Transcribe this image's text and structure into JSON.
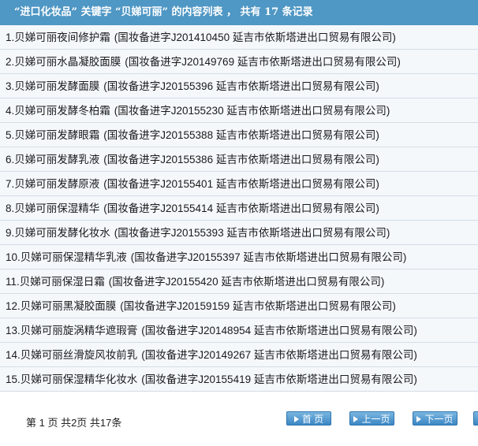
{
  "header": {
    "title": "“进口化妆品” 关键字 “贝娣可丽” 的内容列表 ， 共有 17 条记录"
  },
  "items": [
    {
      "index": "1.",
      "name": "贝娣可丽夜间修护霜",
      "detail": "(国妆备进字J201410450 延吉市依斯塔进出口贸易有限公司)"
    },
    {
      "index": "2.",
      "name": "贝娣可丽水晶凝胶面膜",
      "detail": "(国妆备进字J20149769 延吉市依斯塔进出口贸易有限公司)"
    },
    {
      "index": "3.",
      "name": "贝娣可丽发酵面膜",
      "detail": "(国妆备进字J20155396 延吉市依斯塔进出口贸易有限公司)"
    },
    {
      "index": "4.",
      "name": "贝娣可丽发酵冬柏霜",
      "detail": "(国妆备进字J20155230 延吉市依斯塔进出口贸易有限公司)"
    },
    {
      "index": "5.",
      "name": "贝娣可丽发酵眼霜",
      "detail": "(国妆备进字J20155388 延吉市依斯塔进出口贸易有限公司)"
    },
    {
      "index": "6.",
      "name": "贝娣可丽发酵乳液",
      "detail": "(国妆备进字J20155386 延吉市依斯塔进出口贸易有限公司)"
    },
    {
      "index": "7.",
      "name": "贝娣可丽发酵原液",
      "detail": "(国妆备进字J20155401 延吉市依斯塔进出口贸易有限公司)"
    },
    {
      "index": "8.",
      "name": "贝娣可丽保湿精华",
      "detail": "(国妆备进字J20155414 延吉市依斯塔进出口贸易有限公司)"
    },
    {
      "index": "9.",
      "name": "贝娣可丽发酵化妆水",
      "detail": "(国妆备进字J20155393 延吉市依斯塔进出口贸易有限公司)"
    },
    {
      "index": "10.",
      "name": "贝娣可丽保湿精华乳液",
      "detail": "(国妆备进字J20155397 延吉市依斯塔进出口贸易有限公司)"
    },
    {
      "index": "11.",
      "name": "贝娣可丽保湿日霜",
      "detail": "(国妆备进字J20155420 延吉市依斯塔进出口贸易有限公司)"
    },
    {
      "index": "12.",
      "name": "贝娣可丽黑凝胶面膜",
      "detail": "(国妆备进字J20159159 延吉市依斯塔进出口贸易有限公司)"
    },
    {
      "index": "13.",
      "name": "贝娣可丽旋涡精华遮瑕膏",
      "detail": "(国妆备进字J20148954 延吉市依斯塔进出口贸易有限公司)"
    },
    {
      "index": "14.",
      "name": "贝娣可丽丝滑旋风妆前乳",
      "detail": "(国妆备进字J20149267 延吉市依斯塔进出口贸易有限公司)"
    },
    {
      "index": "15.",
      "name": "贝娣可丽保湿精华化妆水",
      "detail": "(国妆备进字J20155419 延吉市依斯塔进出口贸易有限公司)"
    }
  ],
  "pager": {
    "status": "第 1 页 共2页 共17条",
    "first_label": "首 页",
    "prev_label": "上一页",
    "next_label": "下一页",
    "last_label": ""
  },
  "colors": {
    "header_bg": "#4f97c4",
    "row_bg": "#f4f8fb",
    "button_bg": "#3c87c4"
  }
}
